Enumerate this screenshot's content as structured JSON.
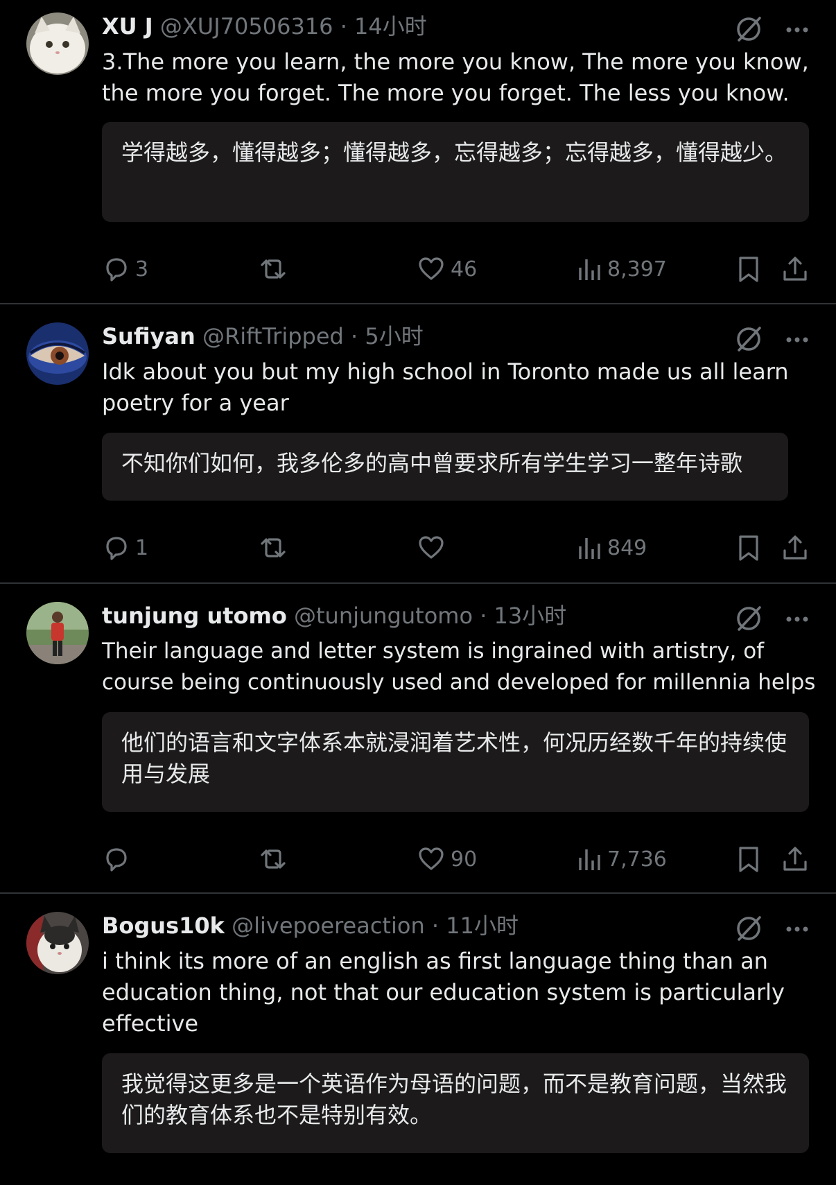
{
  "tweets": [
    {
      "name": "XU J",
      "handle": "@XUJ70506316",
      "separator": "·",
      "time": "14小时",
      "text": "3.The more you learn, the more you know, The more you know, the more you forget. The more you forget. The less you know.",
      "translation": "学得越多，懂得越多；懂得越多，忘得越多；忘得越多，懂得越少。",
      "replies": "3",
      "retweets": "",
      "likes": "46",
      "views": "8,397",
      "avatar_colors": [
        "#c9c4b8",
        "#f2efe8"
      ]
    },
    {
      "name": "Sufiyan",
      "handle": "@RiftTripped",
      "separator": "·",
      "time": "5小时",
      "text": "Idk about you but my high school in Toronto made us all learn poetry for a year",
      "translation": "不知你们如何，我多伦多的高中曾要求所有学生学习一整年诗歌",
      "replies": "1",
      "retweets": "",
      "likes": "",
      "views": "849",
      "avatar_colors": [
        "#1d3d8a",
        "#8a5a3c"
      ]
    },
    {
      "name": "tunjung utomo",
      "handle": "@tunjungutomo",
      "separator": "·",
      "time": "13小时",
      "text": "Their language and letter system is ingrained with artistry, of course being continuously used and developed for millennia helps",
      "translation": "他们的语言和文字体系本就浸润着艺术性，何况历经数千年的持续使用与发展",
      "replies": "",
      "retweets": "",
      "likes": "90",
      "views": "7,736",
      "avatar_colors": [
        "#5d7a4a",
        "#c8372d"
      ]
    },
    {
      "name": "Bogus10k",
      "handle": "@livepoereaction",
      "separator": "·",
      "time": "11小时",
      "text": "i think its more of an english as first language thing than an education thing, not that our education system is particularly effective",
      "translation": "我觉得这更多是一个英语作为母语的问题，而不是教育问题，当然我们的教育体系也不是特别有效。",
      "avatar_colors": [
        "#3a3a3a",
        "#e8e4de"
      ]
    }
  ],
  "colors": {
    "background": "#000000",
    "text": "#e7e9ea",
    "muted": "#71767b",
    "translation_box": "#1c1a1b",
    "divider": "#2f3336"
  },
  "icons": {
    "translate": "translate-icon",
    "more": "more-icon",
    "reply": "reply-icon",
    "retweet": "retweet-icon",
    "like": "heart-icon",
    "views": "views-icon",
    "bookmark": "bookmark-icon",
    "share": "share-icon"
  }
}
